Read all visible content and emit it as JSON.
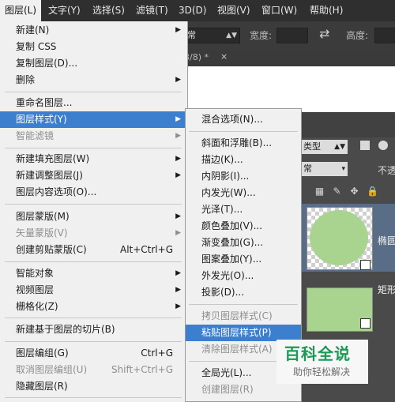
{
  "menubar": {
    "items": [
      {
        "label": "图层(L)",
        "active": true
      },
      {
        "label": "文字(Y)"
      },
      {
        "label": "选择(S)"
      },
      {
        "label": "滤镜(T)"
      },
      {
        "label": "3D(D)"
      },
      {
        "label": "视图(V)"
      },
      {
        "label": "窗口(W)"
      },
      {
        "label": "帮助(H)"
      }
    ]
  },
  "options_bar": {
    "mode_value": "常",
    "width_label": "宽度:",
    "height_label": "高度:",
    "swap_icon": "swap-arrows-icon"
  },
  "document_tab": {
    "title_fragment": "3/8) *",
    "close": "×"
  },
  "layer_menu": {
    "items": [
      {
        "label": "新建(N)",
        "arrow": "▶"
      },
      {
        "label": "复制 CSS"
      },
      {
        "label": "复制图层(D)..."
      },
      {
        "label": "删除",
        "arrow": "▶"
      },
      {
        "label": "重命名图层..."
      },
      {
        "label": "图层样式(Y)",
        "arrow": "▶",
        "highlighted": true
      },
      {
        "label": "智能滤镜",
        "arrow": "▶",
        "disabled": true
      },
      {
        "label": "新建填充图层(W)",
        "arrow": "▶"
      },
      {
        "label": "新建调整图层(J)",
        "arrow": "▶"
      },
      {
        "label": "图层内容选项(O)..."
      },
      {
        "label": "图层蒙版(M)",
        "arrow": "▶"
      },
      {
        "label": "矢量蒙版(V)",
        "arrow": "▶",
        "disabled": true
      },
      {
        "label": "创建剪贴蒙版(C)",
        "shortcut": "Alt+Ctrl+G"
      },
      {
        "label": "智能对象",
        "arrow": "▶"
      },
      {
        "label": "视频图层",
        "arrow": "▶"
      },
      {
        "label": "栅格化(Z)",
        "arrow": "▶"
      },
      {
        "label": "新建基于图层的切片(B)"
      },
      {
        "label": "图层编组(G)",
        "shortcut": "Ctrl+G"
      },
      {
        "label": "取消图层编组(U)",
        "shortcut": "Shift+Ctrl+G",
        "disabled": true
      },
      {
        "label": "隐藏图层(R)"
      }
    ]
  },
  "style_submenu": {
    "items": [
      {
        "label": "混合选项(N)..."
      },
      {
        "label": "斜面和浮雕(B)..."
      },
      {
        "label": "描边(K)..."
      },
      {
        "label": "内阴影(I)..."
      },
      {
        "label": "内发光(W)..."
      },
      {
        "label": "光泽(T)..."
      },
      {
        "label": "颜色叠加(V)..."
      },
      {
        "label": "渐变叠加(G)..."
      },
      {
        "label": "图案叠加(Y)..."
      },
      {
        "label": "外发光(O)..."
      },
      {
        "label": "投影(D)..."
      },
      {
        "label": "拷贝图层样式(C)",
        "disabled": true
      },
      {
        "label": "粘贴图层样式(P)",
        "highlighted": true
      },
      {
        "label": "清除图层样式(A)",
        "disabled": true
      },
      {
        "label": "全局光(L)..."
      },
      {
        "label": "创建图层(R)",
        "disabled": true
      }
    ]
  },
  "layers_panel": {
    "kind_label": "类型",
    "mode_label": "常",
    "opacity_label": "不透",
    "layers": [
      {
        "name": "椭圆",
        "selected": true,
        "fill": "#a8d490"
      },
      {
        "name": "矩形",
        "fill": "#a8d490"
      }
    ]
  },
  "watermark": {
    "title": "百科全说",
    "subtitle": "助你轻松解决"
  },
  "colors": {
    "menu_bg": "#f0f0f0",
    "highlight": "#3c7fcf",
    "shape_green": "#a8d490",
    "watermark_green": "#1a9a54"
  }
}
